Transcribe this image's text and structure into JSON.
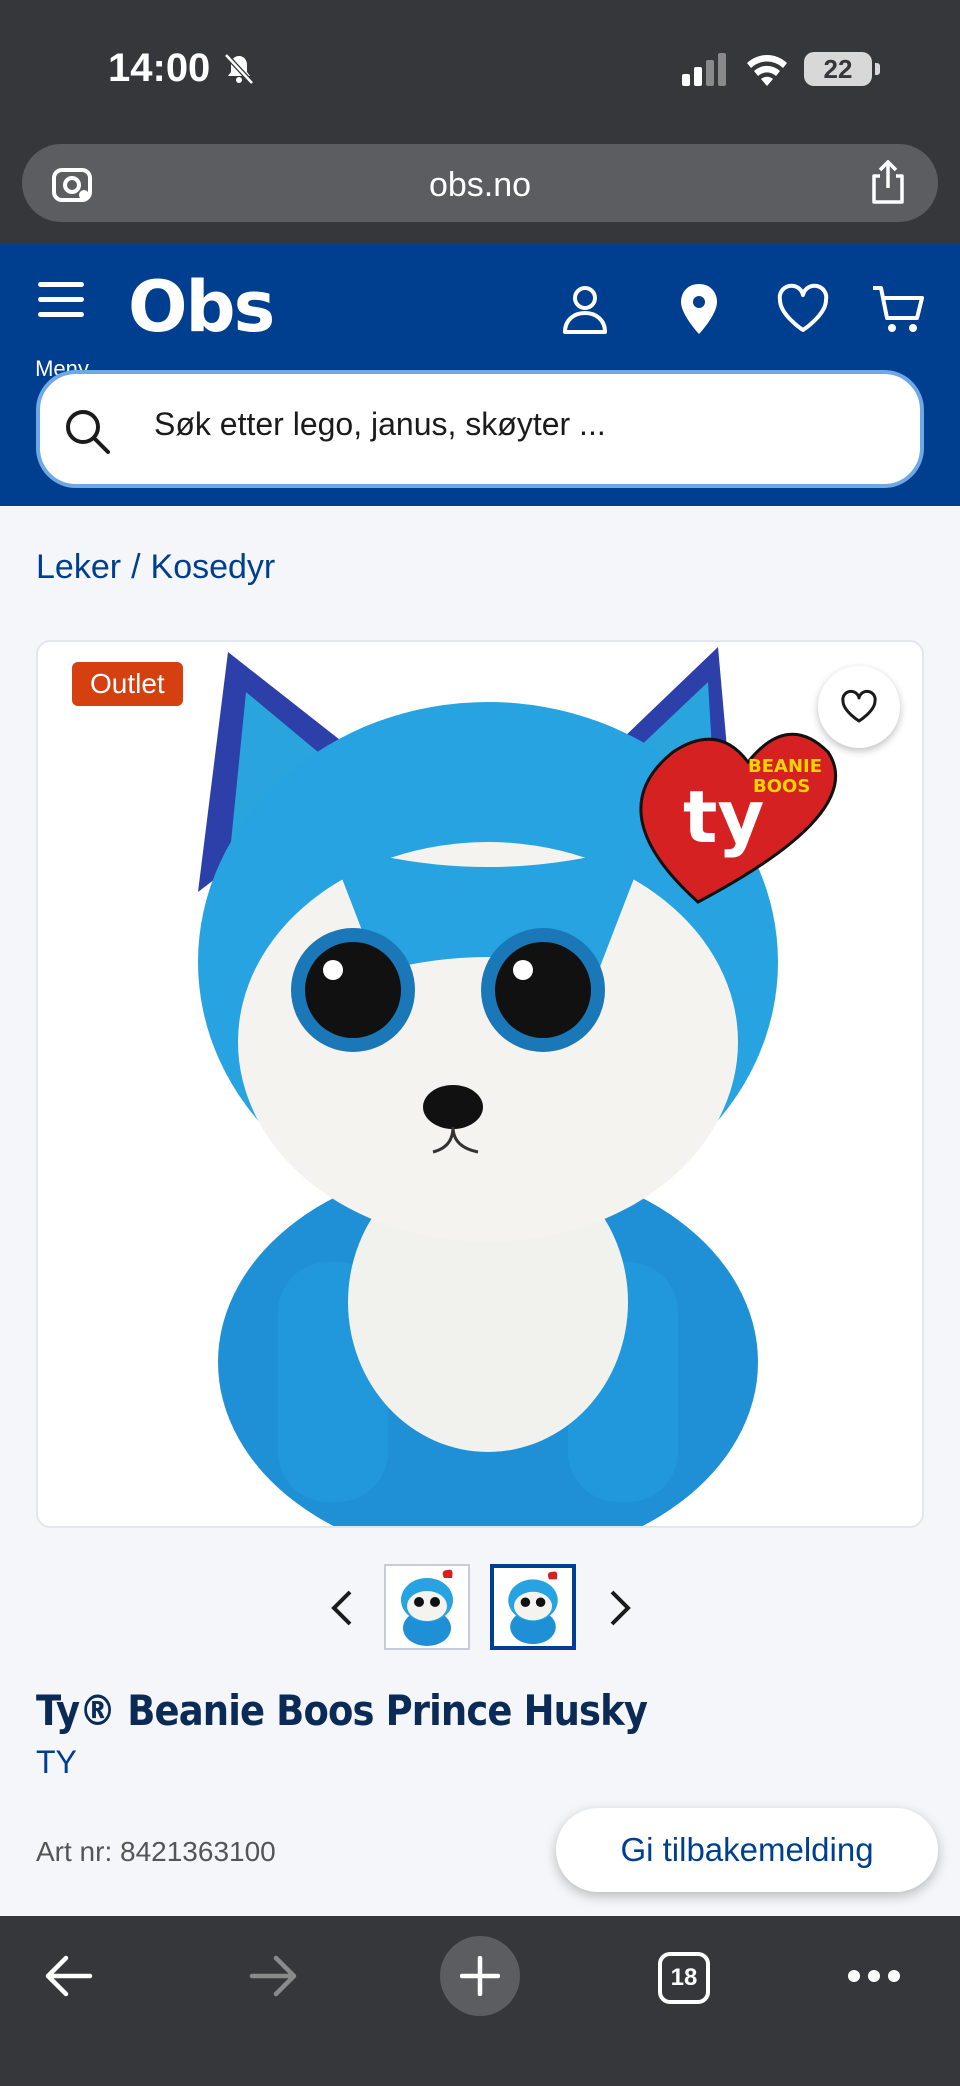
{
  "status": {
    "time": "14:00",
    "battery": "22"
  },
  "browser": {
    "url": "obs.no",
    "tab_count": "18"
  },
  "header": {
    "menu_label": "Meny",
    "logo": "Obs",
    "search_placeholder": "Søk etter lego, janus, skøyter ..."
  },
  "breadcrumb": {
    "items": [
      "Leker",
      "Kosedyr"
    ],
    "separator": "/"
  },
  "product": {
    "badge": "Outlet",
    "title": "Ty® Beanie Boos Prince Husky",
    "brand": "TY",
    "art_nr": "Art nr: 8421363100",
    "thumbnail_count": 2,
    "selected_thumbnail": 2
  },
  "feedback_label": "Gi tilbakemelding",
  "colors": {
    "brand_blue": "#003f8f",
    "badge_orange": "#d4400f",
    "chrome_dark": "#35373a"
  }
}
